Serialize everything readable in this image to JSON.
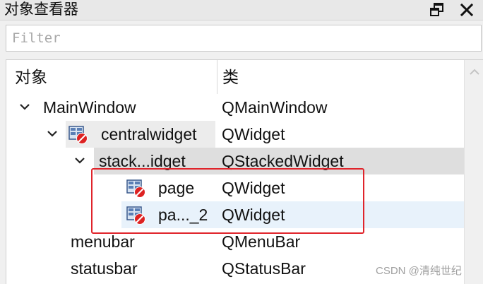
{
  "panel": {
    "title": "对象查看器"
  },
  "filter": {
    "placeholder": "Filter",
    "value": ""
  },
  "tree": {
    "headers": {
      "object": "对象",
      "class": "类"
    },
    "rows": [
      {
        "name": "MainWindow",
        "class": "QMainWindow",
        "expanded": true,
        "icon": null
      },
      {
        "name": "centralwidget",
        "class": "QWidget",
        "expanded": true,
        "icon": "widget-layout-broken-icon"
      },
      {
        "name": "stack...idget",
        "class": "QStackedWidget",
        "expanded": true,
        "icon": null,
        "selected": true
      },
      {
        "name": "page",
        "class": "QWidget",
        "icon": "widget-layout-broken-icon"
      },
      {
        "name": "pa..._2",
        "class": "QWidget",
        "icon": "widget-layout-broken-icon",
        "hovered": true
      },
      {
        "name": "menubar",
        "class": "QMenuBar",
        "icon": null
      },
      {
        "name": "statusbar",
        "class": "QStatusBar",
        "icon": null
      }
    ]
  },
  "icons": {
    "float": "float-window-icon",
    "close": "close-icon",
    "expand": "chevron-down-icon",
    "scroll_up": "scroll-up-icon"
  },
  "colors": {
    "annotation_box": "#e0242b",
    "selection": "#dedede",
    "hover": "#e8f2fb"
  },
  "watermark": "CSDN @清纯世纪"
}
